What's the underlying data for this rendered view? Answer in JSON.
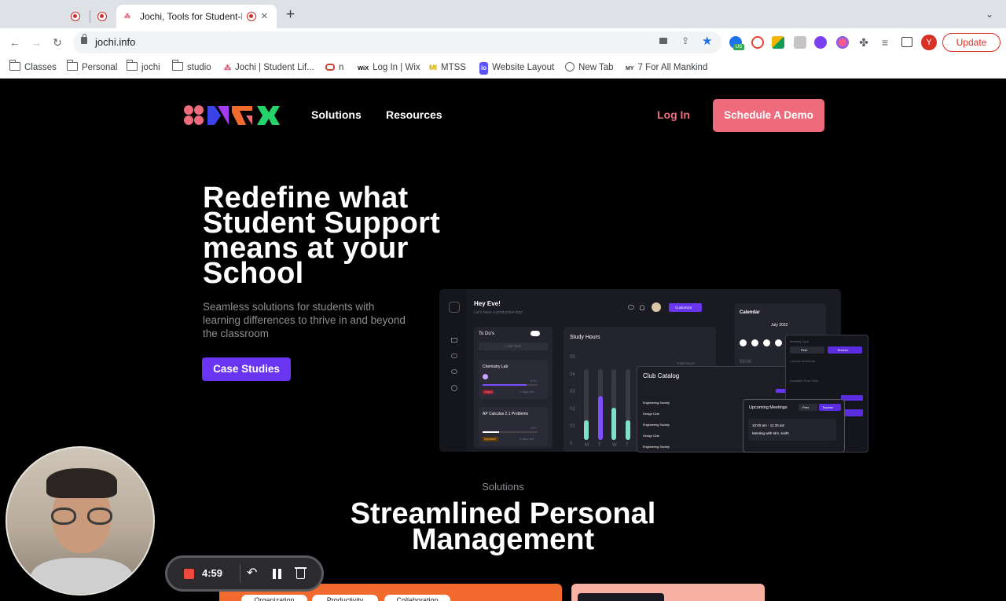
{
  "browser": {
    "active_tab_title": "Jochi, Tools for Student-Li",
    "url": "jochi.info",
    "profile_initial": "Y",
    "update_label": "Update",
    "new_tab_glyph": "+",
    "ext_badge": "US"
  },
  "bookmarks": [
    {
      "label": "Classes",
      "icon": "folder-icon"
    },
    {
      "label": "Personal",
      "icon": "folder-icon"
    },
    {
      "label": "jochi",
      "icon": "folder-icon"
    },
    {
      "label": "studio",
      "icon": "folder-icon"
    },
    {
      "label": "Jochi | Student Lif...",
      "icon": "jochi-favicon"
    },
    {
      "label": "n",
      "icon": "oracle-icon"
    },
    {
      "label": "Log In | Wix",
      "icon": "wix-icon",
      "glyph": "WiX"
    },
    {
      "label": "MTSS",
      "icon": "mtss-icon",
      "glyph": "MI"
    },
    {
      "label": "Website Layout",
      "icon": "io-icon",
      "glyph": "io"
    },
    {
      "label": "New Tab",
      "icon": "globe-icon"
    },
    {
      "label": "7 For All Mankind",
      "icon": "my-icon",
      "glyph": "MY"
    }
  ],
  "site": {
    "nav": {
      "solutions": "Solutions",
      "resources": "Resources",
      "login": "Log In",
      "demo": "Schedule A Demo"
    },
    "hero": {
      "headline": "Redefine what Student Support means at your School",
      "subtext": "Seamless solutions for students with learning differences to thrive in and beyond the classroom",
      "cta": "Case Studies"
    },
    "dashboard": {
      "greeting": "Hey Eve!",
      "tagline": "Let's have a productive day!",
      "customize": "Customize",
      "todo_title": "To Do's",
      "add_task": "+ Add Task",
      "task1": {
        "name": "Chemistry Lab",
        "progress": "80%",
        "tag": "Urgent",
        "due": "3 days left"
      },
      "task2": {
        "name": "AP Calculus 2.1 Problems",
        "progress": "30%",
        "tag": "Important",
        "due": "4 days left"
      },
      "study_hours": "Study Hours",
      "total_hours": "Total Hours",
      "y_ticks": [
        "05",
        "04",
        "03",
        "02",
        "01",
        "0"
      ],
      "x_days": [
        "M",
        "T",
        "W",
        "T"
      ],
      "calendar": "Calendar",
      "month": "July 2022",
      "time_label": "03:00",
      "club_catalog": "Club Catalog",
      "clubs": [
        "Engineering Society",
        "Design Club",
        "Engineering Society",
        "Design Club",
        "Engineering Society"
      ],
      "upcoming": "Upcoming Meetings",
      "peer": "Peer",
      "teacher": "Teacher",
      "meeting_time": "10:00 am - 11:30 am",
      "meeting_with": "Meeting with Mrs. Keith",
      "meeting_type": "Meeting Type",
      "choose_individual": "Choose Individual",
      "available_slots": "Available Time Slots",
      "bars": [
        {
          "track": 0.82,
          "fill": 0.28,
          "color": "#7fe0c8"
        },
        {
          "track": 0.82,
          "fill": 0.62,
          "color": "#7d4dff"
        },
        {
          "track": 0.82,
          "fill": 0.46,
          "color": "#7fe0c8"
        },
        {
          "track": 0.82,
          "fill": 0.28,
          "color": "#7fe0c8"
        }
      ]
    },
    "solutions_label": "Solutions",
    "solutions_heading": "Streamlined Personal Management",
    "pills": [
      "Organization",
      "Productivity",
      "Collaboration"
    ]
  },
  "recorder": {
    "time": "4:59"
  },
  "colors": {
    "accent_purple": "#6a35f0",
    "accent_pink": "#ee6b7c",
    "logo_green": "#24d36a",
    "logo_orange": "#f26a2e"
  }
}
